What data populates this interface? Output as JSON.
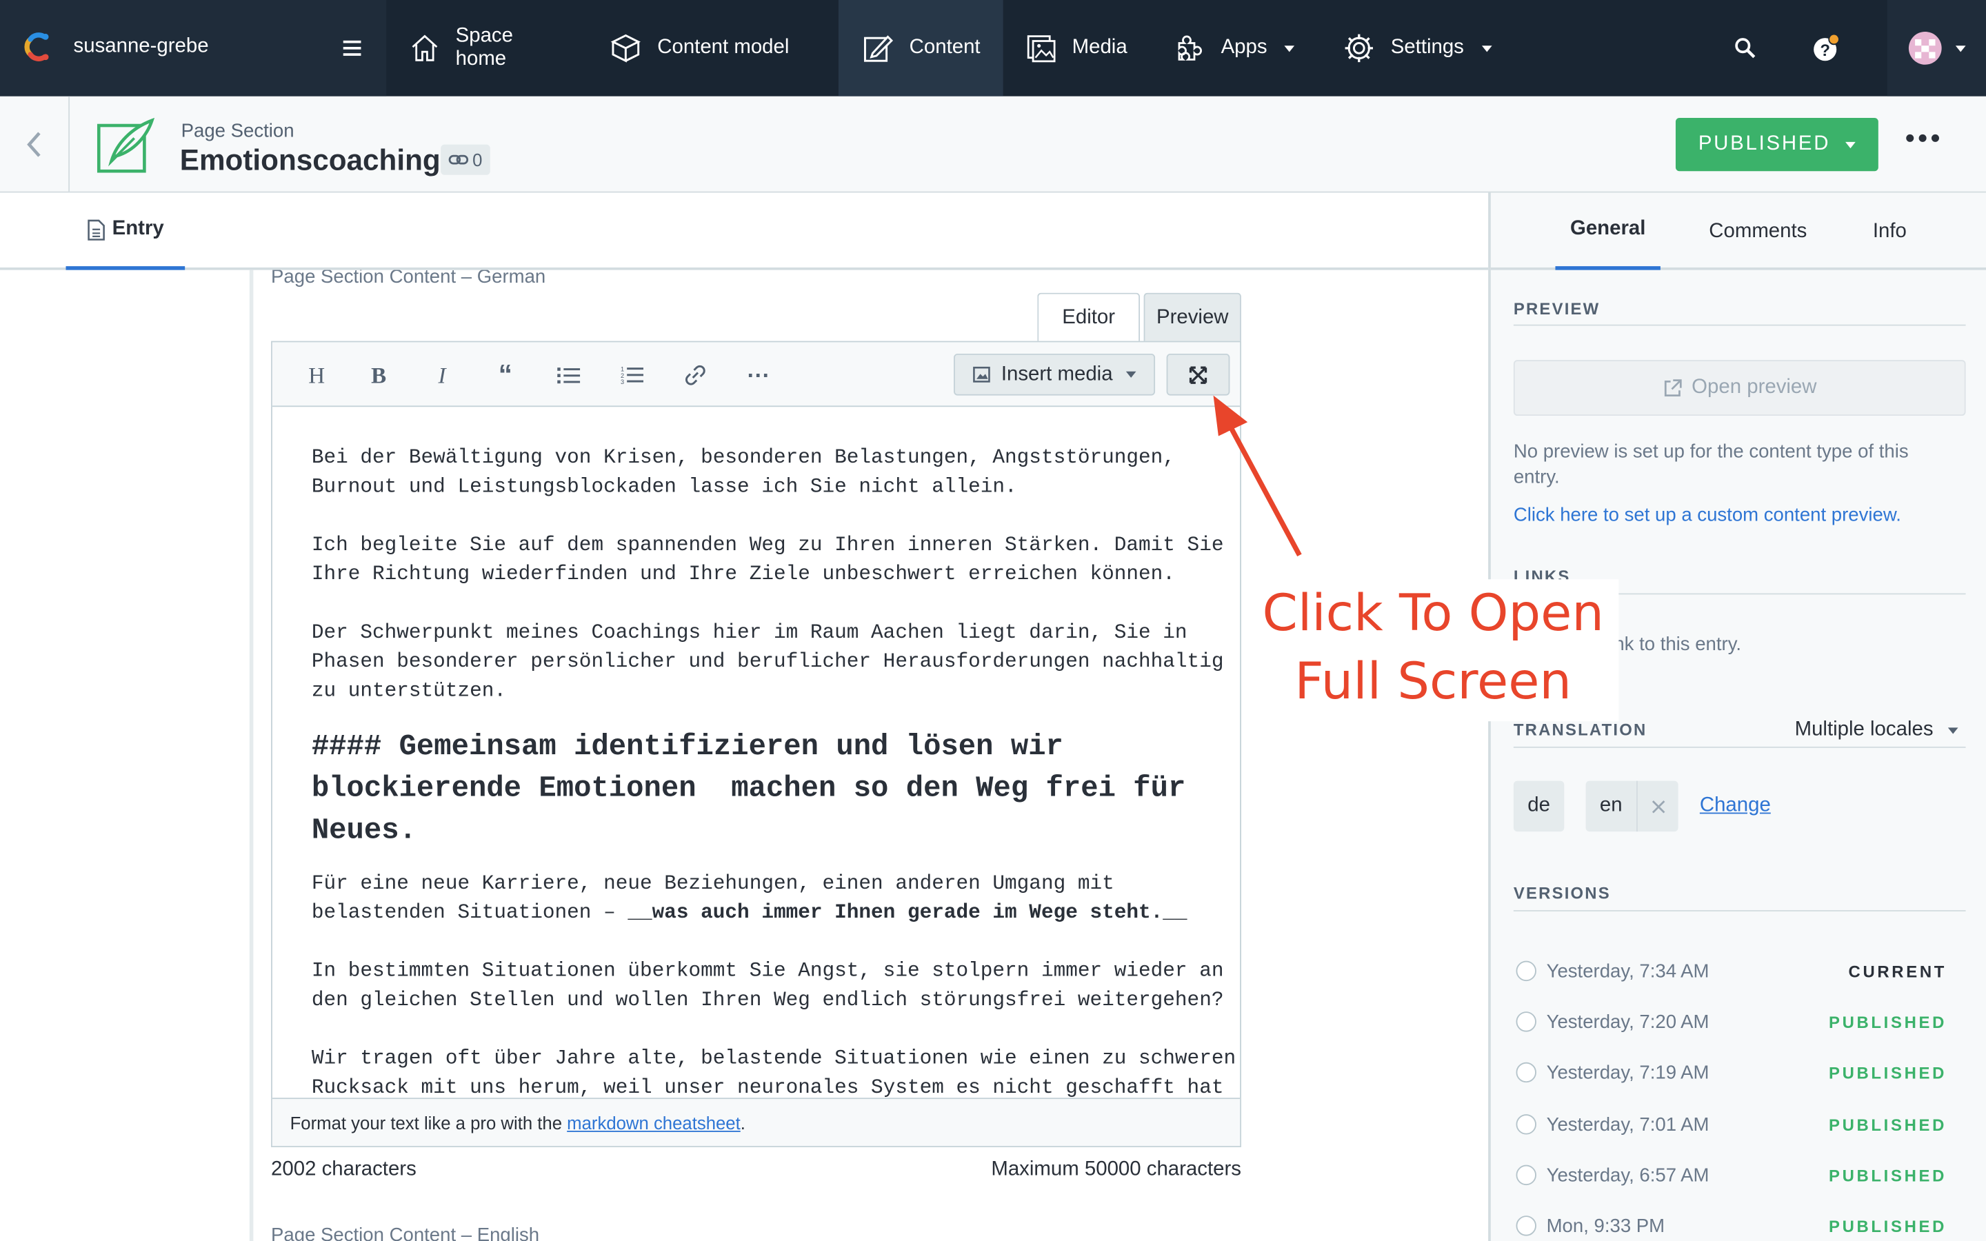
{
  "topnav": {
    "space_name": "susanne-grebe",
    "items": [
      {
        "label": "Space home",
        "icon": "home-icon"
      },
      {
        "label": "Content model",
        "icon": "content-model-icon"
      },
      {
        "label": "Content",
        "icon": "content-icon",
        "active": true
      },
      {
        "label": "Media",
        "icon": "media-icon"
      },
      {
        "label": "Apps",
        "icon": "apps-icon",
        "dropdown": true
      },
      {
        "label": "Settings",
        "icon": "gear-icon",
        "dropdown": true
      }
    ]
  },
  "entry": {
    "content_type": "Page Section",
    "title": "Emotionscoaching",
    "reference_count": "0",
    "status_button": "PUBLISHED"
  },
  "tabs": {
    "entry": "Entry"
  },
  "field": {
    "label": "Page Section Content – German",
    "mode_editor": "Editor",
    "mode_preview": "Preview",
    "insert_media": "Insert media",
    "content": {
      "p1": "Bei der Bewältigung von Krisen, besonderen Belastungen, Angststörungen,\nBurnout und Leistungsblockaden lasse ich Sie nicht allein.",
      "p2": "Ich begleite Sie auf dem spannenden Weg zu Ihren inneren Stärken. Damit Sie\nIhre Richtung wiederfinden und Ihre Ziele unbeschwert erreichen können.",
      "p3": "Der Schwerpunkt meines Coachings hier im Raum Aachen liegt darin, Sie in\nPhasen besonderer persönlicher und beruflicher Herausforderungen nachhaltig\nzu unterstützen.",
      "h4": "#### Gemeinsam identifizieren und lösen wir\nblockierende Emotionen  machen so den Weg frei für\nNeues.",
      "p4a": "Für eine neue Karriere, neue Beziehungen, einen anderen Umgang mit\nbelastenden Situationen – ",
      "p4b": "__was auch immer Ihnen gerade im Wege steht.__",
      "p5": "In bestimmten Situationen überkommt Sie Angst, sie stolpern immer wieder an\nden gleichen Stellen und wollen Ihren Weg endlich störungsfrei weitergehen?",
      "p6": "Wir tragen oft über Jahre alte, belastende Situationen wie einen zu schweren\nRucksack mit uns herum, weil unser neuronales System es nicht geschafft hat"
    },
    "footer_prefix": "Format your text like a pro with the ",
    "footer_link": "markdown cheatsheet",
    "footer_suffix": ".",
    "char_count": "2002 characters",
    "char_max": "Maximum 50000 characters",
    "next_label": "Page Section Content – English"
  },
  "annotation": {
    "line1": "Click To Open",
    "line2": "Full Screen"
  },
  "sidebar": {
    "tabs": [
      "General",
      "Comments",
      "Info"
    ],
    "preview_heading": "PREVIEW",
    "open_preview": "Open preview",
    "no_preview_text": "No preview is set up for the content type of this entry.",
    "setup_link": "Click here to set up a custom content preview.",
    "links_heading": "LINKS",
    "links_text": "No entries link to this entry.",
    "translation_heading": "TRANSLATION",
    "translation_select": "Multiple locales",
    "locales": [
      "de",
      "en"
    ],
    "change_link": "Change",
    "versions_heading": "VERSIONS",
    "versions": [
      {
        "when": "Yesterday, 7:34 AM",
        "status": "CURRENT"
      },
      {
        "when": "Yesterday, 7:20 AM",
        "status": "PUBLISHED"
      },
      {
        "when": "Yesterday, 7:19 AM",
        "status": "PUBLISHED"
      },
      {
        "when": "Yesterday, 7:01 AM",
        "status": "PUBLISHED"
      },
      {
        "when": "Yesterday, 6:57 AM",
        "status": "PUBLISHED"
      },
      {
        "when": "Mon, 9:33 PM",
        "status": "PUBLISHED"
      }
    ]
  },
  "colors": {
    "topbar": "#192532",
    "accent_blue": "#2e75d4",
    "published_green": "#3bb26a",
    "annotation_red": "#e8452b"
  }
}
